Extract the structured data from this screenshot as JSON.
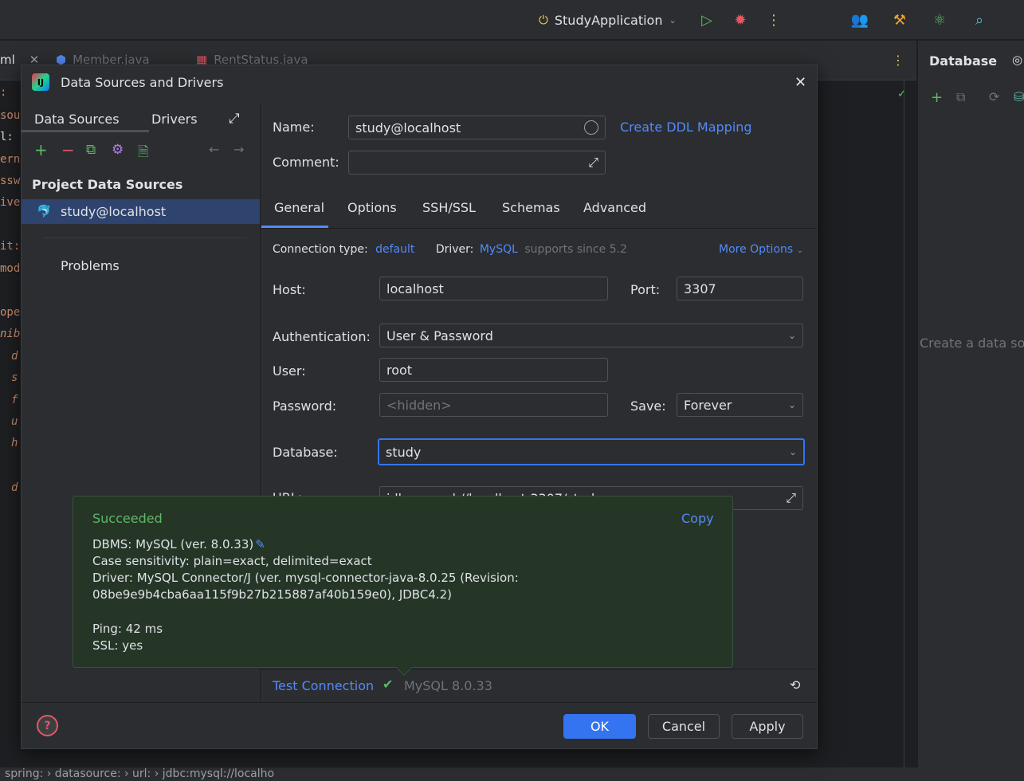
{
  "toolbar": {
    "run_config": "StudyApplication",
    "icons": [
      "power-icon",
      "chevron-down-icon",
      "run-icon",
      "debug-icon",
      "more-icon",
      "people-icon",
      "tools-icon",
      "atom-icon",
      "search-icon"
    ]
  },
  "editor": {
    "tabs": [
      "ml",
      "Member.java",
      "RentStatus.java"
    ],
    "code_fragments": [
      ":",
      "sou",
      "l:",
      "ern",
      "ssw",
      "ive",
      "it:",
      "mod",
      "ope",
      "nib",
      "d",
      "s",
      "f",
      "u",
      "h",
      "d"
    ],
    "breadcrumb": "spring: › datasource: › url: › jdbc:mysql://localho"
  },
  "db_panel": {
    "title": "Database",
    "hint": "Create a data sou"
  },
  "dialog": {
    "title": "Data Sources and Drivers",
    "left": {
      "tabs": [
        "Data Sources",
        "Drivers"
      ],
      "section_title": "Project Data Sources",
      "items": [
        "study@localhost"
      ],
      "problems": "Problems"
    },
    "name_label": "Name:",
    "name_value": "study@localhost",
    "create_ddl": "Create DDL Mapping",
    "comment_label": "Comment:",
    "comment_value": "",
    "tabs": [
      "General",
      "Options",
      "SSH/SSL",
      "Schemas",
      "Advanced"
    ],
    "conn_type_label": "Connection type:",
    "conn_type_value": "default",
    "driver_label": "Driver:",
    "driver_value": "MySQL",
    "driver_note": "supports since 5.2",
    "more_options": "More Options",
    "host_label": "Host:",
    "host_value": "localhost",
    "port_label": "Port:",
    "port_value": "3307",
    "auth_label": "Authentication:",
    "auth_value": "User & Password",
    "user_label": "User:",
    "user_value": "root",
    "password_label": "Password:",
    "password_placeholder": "<hidden>",
    "save_label": "Save:",
    "save_value": "Forever",
    "database_label": "Database:",
    "database_value": "study",
    "url_label": "URL:",
    "url_value": "jdbc:mysql://localhost:3307/study",
    "test_connection": "Test Connection",
    "test_result": "MySQL 8.0.33",
    "ok": "OK",
    "cancel": "Cancel",
    "apply": "Apply"
  },
  "popup": {
    "status": "Succeeded",
    "copy": "Copy",
    "dbms": "DBMS: MySQL (ver. 8.0.33)",
    "case": "Case sensitivity: plain=exact, delimited=exact",
    "driver1": "Driver: MySQL Connector/J (ver. mysql-connector-java-8.0.25 (Revision:",
    "driver2": "08be9e9b4cba6aa115f9b27b215887af40b159e0), JDBC4.2)",
    "ping": "Ping: 42 ms",
    "ssl": "SSL: yes"
  },
  "colors": {
    "accent": "#3574f0",
    "link": "#548af7",
    "success": "#5fb865",
    "popup_bg": "#253627"
  }
}
